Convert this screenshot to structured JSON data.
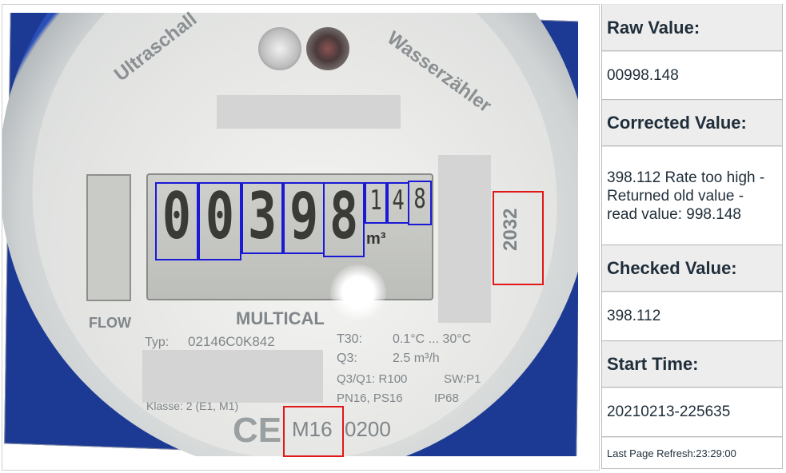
{
  "panel": {
    "raw_label": "Raw Value:",
    "raw_value": "00998.148",
    "corrected_label": "Corrected Value:",
    "corrected_value": "398.112 Rate too high - Returned old value - read value: 998.148",
    "checked_label": "Checked Value:",
    "checked_value": "398.112",
    "start_label": "Start Time:",
    "start_value": "20210213-225635",
    "refresh": "Last Page Refresh:23:29:00"
  },
  "meter": {
    "brand_left": "Ultraschall",
    "brand_right": "Wasserzähler",
    "digits_big": [
      "0",
      "0",
      "3",
      "9",
      "8"
    ],
    "digits_small": [
      "1",
      "4",
      "8"
    ],
    "unit": "m³",
    "flow_label": "FLOW",
    "model": "MULTICAL",
    "typ_label": "Typ:",
    "typ_value": "02146C0K842",
    "t30": "T30:",
    "t30_value": "0.1°C ... 30°C",
    "q3": "Q3:",
    "q3_value": "2.5 m³/h",
    "q3q1": "Q3/Q1: R100",
    "sw": "SW:P1",
    "pn": "PN16, PS16",
    "ip": "IP68",
    "klasse": "Klasse: 2 (E1, M1)",
    "ce": "CE",
    "m16": "M16",
    "code": "0200",
    "year": "2032"
  },
  "colors": {
    "digit_box": "#1a1ad6",
    "ref_box": "#e01818",
    "dial_blue": "#2246ad"
  }
}
